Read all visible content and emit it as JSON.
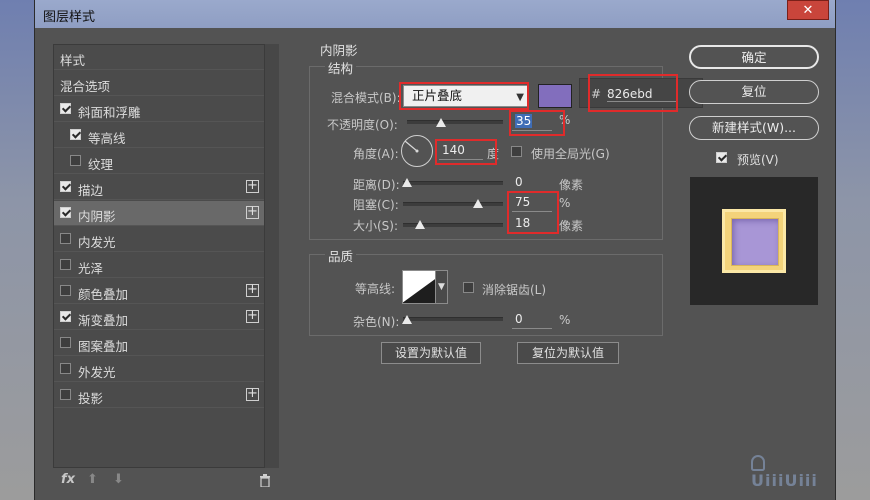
{
  "window": {
    "title": "图层样式",
    "close": "✕"
  },
  "left_panel": {
    "items": [
      {
        "label": "样式",
        "checkbox": false,
        "checked": false,
        "plus": false,
        "indent": 0
      },
      {
        "label": "混合选项",
        "checkbox": false,
        "checked": false,
        "plus": false,
        "indent": 0
      },
      {
        "label": "斜面和浮雕",
        "checkbox": true,
        "checked": true,
        "plus": false,
        "indent": 0
      },
      {
        "label": "等高线",
        "checkbox": true,
        "checked": true,
        "plus": false,
        "indent": 1
      },
      {
        "label": "纹理",
        "checkbox": true,
        "checked": false,
        "plus": false,
        "indent": 1
      },
      {
        "label": "描边",
        "checkbox": true,
        "checked": true,
        "plus": true,
        "indent": 0
      },
      {
        "label": "内阴影",
        "checkbox": true,
        "checked": true,
        "plus": true,
        "indent": 0,
        "selected": true
      },
      {
        "label": "内发光",
        "checkbox": true,
        "checked": false,
        "plus": false,
        "indent": 0
      },
      {
        "label": "光泽",
        "checkbox": true,
        "checked": false,
        "plus": false,
        "indent": 0
      },
      {
        "label": "颜色叠加",
        "checkbox": true,
        "checked": false,
        "plus": true,
        "indent": 0
      },
      {
        "label": "渐变叠加",
        "checkbox": true,
        "checked": true,
        "plus": true,
        "indent": 0
      },
      {
        "label": "图案叠加",
        "checkbox": true,
        "checked": false,
        "plus": false,
        "indent": 0
      },
      {
        "label": "外发光",
        "checkbox": true,
        "checked": false,
        "plus": false,
        "indent": 0
      },
      {
        "label": "投影",
        "checkbox": true,
        "checked": false,
        "plus": true,
        "indent": 0
      }
    ],
    "footer": {
      "fx": "fx",
      "up": "⬆",
      "down": "⬇",
      "trash": "🗑"
    }
  },
  "inner_shadow": {
    "section_title": "内阴影",
    "structure_title": "结构",
    "blend_mode_label": "混合模式(B):",
    "blend_mode_value": "正片叠底",
    "hex_prefix": "#",
    "hex_value": "826ebd",
    "opacity_label": "不透明度(O):",
    "opacity_value": "35",
    "opacity_unit": "%",
    "angle_label": "角度(A):",
    "angle_value": "140",
    "angle_unit": "度",
    "global_light_label": "使用全局光(G)",
    "distance_label": "距离(D):",
    "distance_value": "0",
    "distance_unit": "像素",
    "choke_label": "阻塞(C):",
    "choke_value": "75",
    "choke_unit": "%",
    "size_label": "大小(S):",
    "size_value": "18",
    "size_unit": "像素",
    "quality_title": "品质",
    "contour_label": "等高线:",
    "antialias_label": "消除锯齿(L)",
    "noise_label": "杂色(N):",
    "noise_value": "0",
    "noise_unit": "%",
    "set_default": "设置为默认值",
    "reset_default": "复位为默认值"
  },
  "right_panel": {
    "ok": "确定",
    "reset": "复位",
    "new_style": "新建样式(W)...",
    "preview_label": "预览(V)"
  },
  "colors": {
    "swatch": "#826ebd",
    "highlight": "#e02b2b"
  },
  "watermark": "UiiiUiii"
}
